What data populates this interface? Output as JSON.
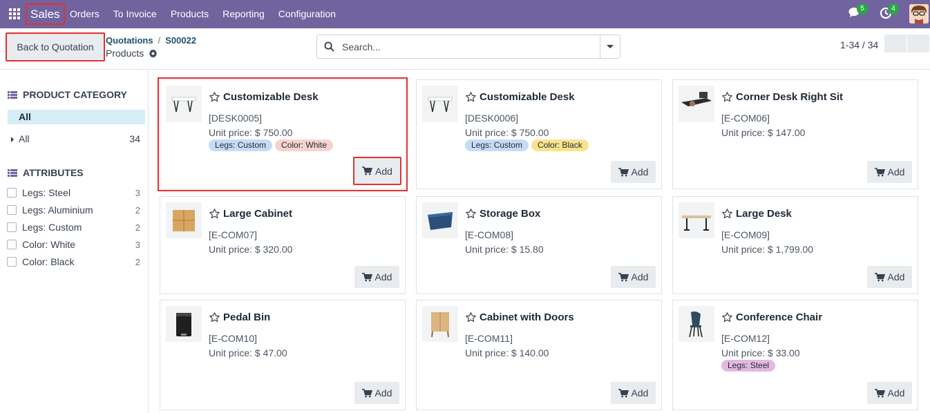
{
  "navbar": {
    "brand": "Sales",
    "menu": [
      "Orders",
      "To Invoice",
      "Products",
      "Reporting",
      "Configuration"
    ],
    "chat_count": "5",
    "activity_count": "4",
    "icons": [
      "apps-grid-icon",
      "chat-icon",
      "clock-icon",
      "user-avatar"
    ]
  },
  "control": {
    "back_label": "Back to Quotation",
    "breadcrumb": [
      "Quotations",
      "S00022"
    ],
    "subtitle": "Products",
    "search_placeholder": "Search...",
    "pager": "1-34 / 34"
  },
  "sidebar": {
    "category_title": "PRODUCT CATEGORY",
    "category_active": "All",
    "category_item": {
      "label": "All",
      "count": "34"
    },
    "attributes_title": "ATTRIBUTES",
    "attributes": [
      {
        "label": "Legs: Steel",
        "count": "3"
      },
      {
        "label": "Legs: Aluminium",
        "count": "2"
      },
      {
        "label": "Legs: Custom",
        "count": "2"
      },
      {
        "label": "Color: White",
        "count": "3"
      },
      {
        "label": "Color: Black",
        "count": "2"
      }
    ]
  },
  "products": [
    {
      "name": "Customizable Desk",
      "code": "[DESK0005]",
      "price": "Unit price: $ 750.00",
      "tags": [
        "Legs: Custom",
        "Color: White"
      ],
      "add": "Add"
    },
    {
      "name": "Customizable Desk",
      "code": "[DESK0006]",
      "price": "Unit price: $ 750.00",
      "tags": [
        "Legs: Custom",
        "Color: Black"
      ],
      "add": "Add"
    },
    {
      "name": "Corner Desk Right Sit",
      "code": "[E-COM06]",
      "price": "Unit price: $ 147.00",
      "tags": [],
      "add": "Add"
    },
    {
      "name": "Large Cabinet",
      "code": "[E-COM07]",
      "price": "Unit price: $ 320.00",
      "tags": [],
      "add": "Add"
    },
    {
      "name": "Storage Box",
      "code": "[E-COM08]",
      "price": "Unit price: $ 15.80",
      "tags": [],
      "add": "Add"
    },
    {
      "name": "Large Desk",
      "code": "[E-COM09]",
      "price": "Unit price: $ 1,799.00",
      "tags": [],
      "add": "Add"
    },
    {
      "name": "Pedal Bin",
      "code": "[E-COM10]",
      "price": "Unit price: $ 47.00",
      "tags": [],
      "add": "Add"
    },
    {
      "name": "Cabinet with Doors",
      "code": "[E-COM11]",
      "price": "Unit price: $ 140.00",
      "tags": [],
      "add": "Add"
    },
    {
      "name": "Conference Chair",
      "code": "[E-COM12]",
      "price": "Unit price: $ 33.00",
      "tags": [
        "Legs: Steel"
      ],
      "add": "Add"
    }
  ],
  "colors": {
    "navbar": "#71639e",
    "highlight": "#e03131",
    "tag_legs": "#c7dbf7",
    "tag_color_white": "#f6d4cd",
    "tag_color_black": "#fbe38c",
    "tag_legs_steel": "#e2b8e0"
  }
}
